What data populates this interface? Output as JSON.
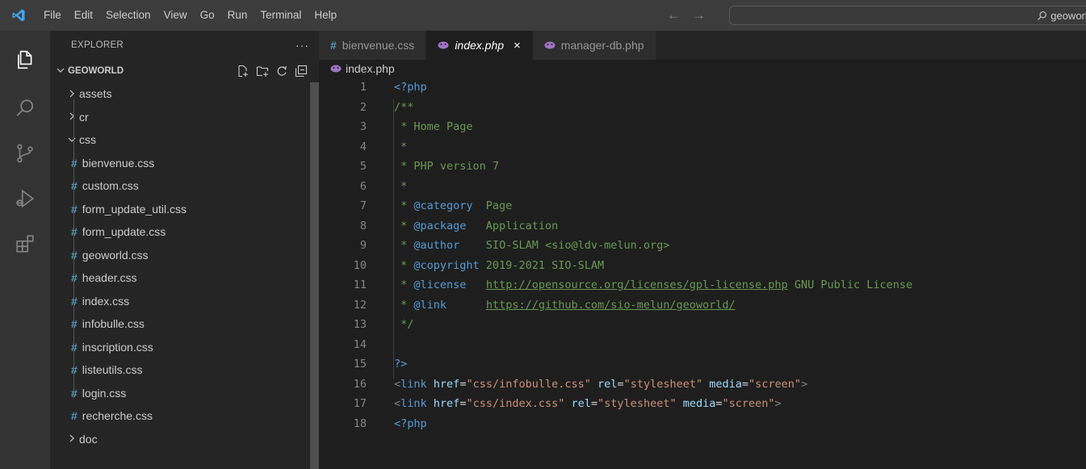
{
  "menu": [
    "File",
    "Edit",
    "Selection",
    "View",
    "Go",
    "Run",
    "Terminal",
    "Help"
  ],
  "command_center": {
    "text": "geoworld"
  },
  "explorer": {
    "title": "EXPLORER",
    "more": "···",
    "workspace": "GEOWORLD",
    "tree": [
      {
        "type": "folder",
        "label": "assets",
        "open": false,
        "level": 0
      },
      {
        "type": "folder",
        "label": "cr",
        "open": false,
        "level": 0
      },
      {
        "type": "folder",
        "label": "css",
        "open": true,
        "level": 0
      },
      {
        "type": "file",
        "label": "bienvenue.css",
        "level": 1
      },
      {
        "type": "file",
        "label": "custom.css",
        "level": 1
      },
      {
        "type": "file",
        "label": "form_update_util.css",
        "level": 1
      },
      {
        "type": "file",
        "label": "form_update.css",
        "level": 1
      },
      {
        "type": "file",
        "label": "geoworld.css",
        "level": 1
      },
      {
        "type": "file",
        "label": "header.css",
        "level": 1
      },
      {
        "type": "file",
        "label": "index.css",
        "level": 1
      },
      {
        "type": "file",
        "label": "infobulle.css",
        "level": 1
      },
      {
        "type": "file",
        "label": "inscription.css",
        "level": 1
      },
      {
        "type": "file",
        "label": "listeutils.css",
        "level": 1
      },
      {
        "type": "file",
        "label": "login.css",
        "level": 1
      },
      {
        "type": "file",
        "label": "recherche.css",
        "level": 1
      },
      {
        "type": "folder",
        "label": "doc",
        "open": false,
        "level": 0
      }
    ]
  },
  "tabs": [
    {
      "label": "bienvenue.css",
      "kind": "css",
      "active": false
    },
    {
      "label": "index.php",
      "kind": "php",
      "active": true
    },
    {
      "label": "manager-db.php",
      "kind": "php",
      "active": false
    }
  ],
  "tab_close": "×",
  "breadcrumb": "index.php",
  "code_lines": [
    {
      "n": "1",
      "tokens": [
        [
          "tag",
          "<?php"
        ]
      ]
    },
    {
      "n": "2",
      "tokens": [
        [
          "cmt",
          "/**"
        ]
      ]
    },
    {
      "n": "3",
      "tokens": [
        [
          "cmt",
          " * Home Page"
        ]
      ]
    },
    {
      "n": "4",
      "tokens": [
        [
          "cmt",
          " *"
        ]
      ]
    },
    {
      "n": "5",
      "tokens": [
        [
          "cmt",
          " * PHP version 7"
        ]
      ]
    },
    {
      "n": "6",
      "tokens": [
        [
          "cmt",
          " *"
        ]
      ]
    },
    {
      "n": "7",
      "tokens": [
        [
          "cmt",
          " * "
        ],
        [
          "doc",
          "@category"
        ],
        [
          "cmt",
          "  Page"
        ]
      ]
    },
    {
      "n": "8",
      "tokens": [
        [
          "cmt",
          " * "
        ],
        [
          "doc",
          "@package"
        ],
        [
          "cmt",
          "   Application"
        ]
      ]
    },
    {
      "n": "9",
      "tokens": [
        [
          "cmt",
          " * "
        ],
        [
          "doc",
          "@author"
        ],
        [
          "cmt",
          "    SIO-SLAM <sio@ldv-melun.org>"
        ]
      ]
    },
    {
      "n": "10",
      "tokens": [
        [
          "cmt",
          " * "
        ],
        [
          "doc",
          "@copyright"
        ],
        [
          "cmt",
          " 2019-2021 SIO-SLAM"
        ]
      ]
    },
    {
      "n": "11",
      "tokens": [
        [
          "cmt",
          " * "
        ],
        [
          "doc",
          "@license"
        ],
        [
          "cmt",
          "   "
        ],
        [
          "link",
          "http://opensource.org/licenses/gpl-license.php"
        ],
        [
          "cmt",
          " GNU Public License"
        ]
      ]
    },
    {
      "n": "12",
      "tokens": [
        [
          "cmt",
          " * "
        ],
        [
          "doc",
          "@link"
        ],
        [
          "cmt",
          "      "
        ],
        [
          "link",
          "https://github.com/sio-melun/geoworld/"
        ]
      ]
    },
    {
      "n": "13",
      "tokens": [
        [
          "cmt",
          " */"
        ]
      ]
    },
    {
      "n": "14",
      "tokens": []
    },
    {
      "n": "15",
      "tokens": [
        [
          "tag",
          "?>"
        ]
      ]
    },
    {
      "n": "16",
      "tokens": [
        [
          "punc",
          "<"
        ],
        [
          "tag",
          "link"
        ],
        [
          "txt",
          " "
        ],
        [
          "attr",
          "href"
        ],
        [
          "txt",
          "="
        ],
        [
          "str",
          "\"css/infobulle.css\""
        ],
        [
          "txt",
          " "
        ],
        [
          "attr",
          "rel"
        ],
        [
          "txt",
          "="
        ],
        [
          "str",
          "\"stylesheet\""
        ],
        [
          "txt",
          " "
        ],
        [
          "attr",
          "media"
        ],
        [
          "txt",
          "="
        ],
        [
          "str",
          "\"screen\""
        ],
        [
          "punc",
          ">"
        ]
      ]
    },
    {
      "n": "17",
      "tokens": [
        [
          "punc",
          "<"
        ],
        [
          "tag",
          "link"
        ],
        [
          "txt",
          " "
        ],
        [
          "attr",
          "href"
        ],
        [
          "txt",
          "="
        ],
        [
          "str",
          "\"css/index.css\""
        ],
        [
          "txt",
          " "
        ],
        [
          "attr",
          "rel"
        ],
        [
          "txt",
          "="
        ],
        [
          "str",
          "\"stylesheet\""
        ],
        [
          "txt",
          " "
        ],
        [
          "attr",
          "media"
        ],
        [
          "txt",
          "="
        ],
        [
          "str",
          "\"screen\""
        ],
        [
          "punc",
          ">"
        ]
      ]
    },
    {
      "n": "18",
      "tokens": [
        [
          "tag",
          "<?php"
        ]
      ]
    }
  ],
  "colors": {
    "titlebar": "#3c3c3c",
    "activitybar": "#333333",
    "sidebar": "#252526",
    "editor": "#1e1e1e",
    "css_icon": "#519aba",
    "php_icon": "#a074c4"
  }
}
